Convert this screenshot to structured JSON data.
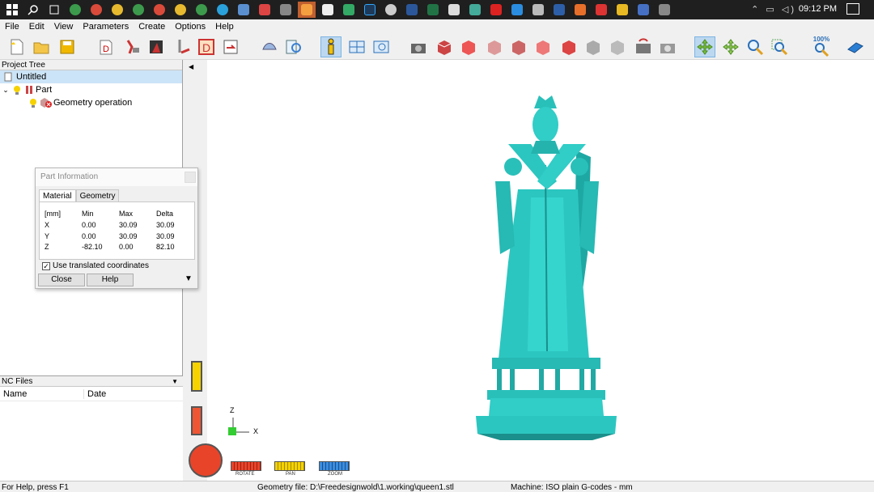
{
  "menu": [
    "File",
    "Edit",
    "View",
    "Parameters",
    "Create",
    "Options",
    "Help"
  ],
  "toolbar": {
    "zoom_pct": "100%"
  },
  "taskbar": {
    "time": "09:12 PM"
  },
  "project_tree": {
    "header": "Project Tree",
    "root": "Untitled",
    "part": "Part",
    "operation": "Geometry operation"
  },
  "nc_files": {
    "header": "NC Files",
    "col_name": "Name",
    "col_date": "Date"
  },
  "dialog": {
    "title": "Part Information",
    "tabs": [
      "Material",
      "Geometry"
    ],
    "unit": "[mm]",
    "headers": [
      "Min",
      "Max",
      "Delta"
    ],
    "rows": [
      {
        "axis": "X",
        "min": "0.00",
        "max": "30.09",
        "delta": "30.09"
      },
      {
        "axis": "Y",
        "min": "0.00",
        "max": "30.09",
        "delta": "30.09"
      },
      {
        "axis": "Z",
        "min": "-82.10",
        "max": "0.00",
        "delta": "82.10"
      }
    ],
    "checkbox": "Use translated coordinates",
    "close": "Close",
    "help": "Help"
  },
  "viewport": {
    "axis_z": "Z",
    "axis_x": "X",
    "mouse_modes": [
      "ROTATE",
      "PAN",
      "ZOOM"
    ]
  },
  "status": {
    "help": "For Help, press F1",
    "file": "Geometry file: D:\\Freedesignwold\\1.working\\queen1.stl",
    "machine": "Machine: ISO plain G-codes - mm"
  }
}
